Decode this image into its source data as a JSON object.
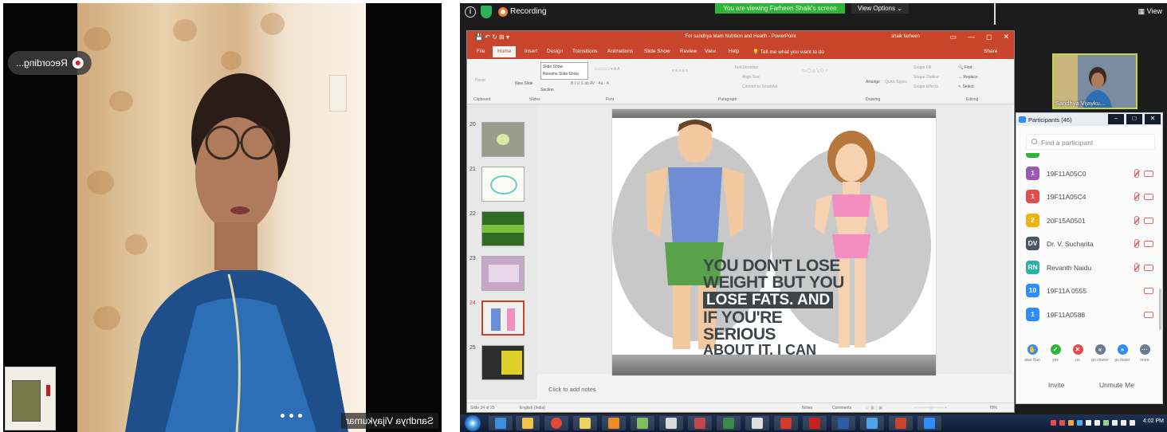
{
  "left_video": {
    "recording_label": "Recording...",
    "name_tag": "Sandhya Vijaykumar"
  },
  "zoom_bar": {
    "recording_label": "Recording",
    "viewing_banner": "You are viewing Farheen Shaik's screen",
    "view_options": "View Options ⌄",
    "view_button": "View",
    "info_icon": "info-icon",
    "shield_icon": "shield-icon"
  },
  "powerpoint": {
    "window_title": "For sandhya Mam Nutrition and Health  -  PowerPoint",
    "user_name": "shaik farheen",
    "menu_tabs": [
      "File",
      "Home",
      "Insert",
      "Design",
      "Transitions",
      "Animations",
      "Slide Show",
      "Review",
      "View",
      "Help",
      "Tell me what you want to do",
      "Share"
    ],
    "active_tab": "Home",
    "ribbon": {
      "groups": [
        "Clipboard",
        "Slides",
        "Font",
        "Paragraph",
        "Drawing",
        "Editing"
      ],
      "paste": "Paste",
      "new_slide": "New Slide",
      "section": "Section",
      "slideshow_menu": [
        "Slide Show",
        "Resume Slide Show"
      ],
      "text_direction": "Text Direction",
      "align_text": "Align Text",
      "convert_smartart": "Convert to SmartArt",
      "arrange": "Arrange",
      "quick_styles": "Quick Styles",
      "shape_fill": "Shape Fill",
      "shape_outline": "Shape Outline",
      "shape_effects": "Shape Effects",
      "find": "Find",
      "replace": "Replace",
      "select": "Select"
    },
    "thumbnails": [
      "20",
      "21",
      "22",
      "23",
      "24",
      "25"
    ],
    "selected_slide": "24",
    "slide_text": {
      "line1": "YOU DON'T LOSE",
      "line2": "WEIGHT BUT YOU",
      "line3": "LOSE FATS. AND",
      "line4": "IF YOU'RE SERIOUS",
      "line5": "ABOUT IT, I CAN HELP."
    },
    "notes_placeholder": "Click to add notes",
    "status": {
      "slide_count": "Slide 24 of 25",
      "language": "English (India)",
      "notes": "Notes",
      "comments": "Comments",
      "zoom": "79%"
    }
  },
  "self_view": {
    "name": "Sandhya Vijayku..."
  },
  "participants": {
    "title": "Participants (46)",
    "search_placeholder": "Find a participant",
    "rows": [
      {
        "initials": "1",
        "name": "19F11A05C0",
        "color": "#9b59b6",
        "mic": true
      },
      {
        "initials": "1",
        "name": "19F11A05C4",
        "color": "#e24c4c",
        "mic": true
      },
      {
        "initials": "2",
        "name": "20F15A0501",
        "color": "#f1b10e",
        "mic": true
      },
      {
        "initials": "DV",
        "name": "Dr. V. Sucharita",
        "color": "#4a5465",
        "mic": true
      },
      {
        "initials": "RN",
        "name": "Revanth Naidu",
        "color": "#27b3a3",
        "mic": true
      },
      {
        "initials": "10",
        "name": "19F11A 0555",
        "color": "#2d8cff",
        "mic": false
      },
      {
        "initials": "1",
        "name": "19F11A0588",
        "color": "#2d8cff",
        "mic": false
      }
    ],
    "reactions": [
      {
        "label": "aise Han",
        "color": "#2d8cff",
        "glyph": "✋"
      },
      {
        "label": "yes",
        "color": "#2fb53a",
        "glyph": "✓"
      },
      {
        "label": "no",
        "color": "#e24c4c",
        "glyph": "✕"
      },
      {
        "label": "go slower",
        "color": "#6b7a90",
        "glyph": "«"
      },
      {
        "label": "go faster",
        "color": "#2d8cff",
        "glyph": "»"
      },
      {
        "label": "more",
        "color": "#6b7a90",
        "glyph": "···"
      }
    ],
    "invite": "Invite",
    "unmute_me": "Unmute Me"
  },
  "taskbar": {
    "time": "4:02 PM"
  }
}
